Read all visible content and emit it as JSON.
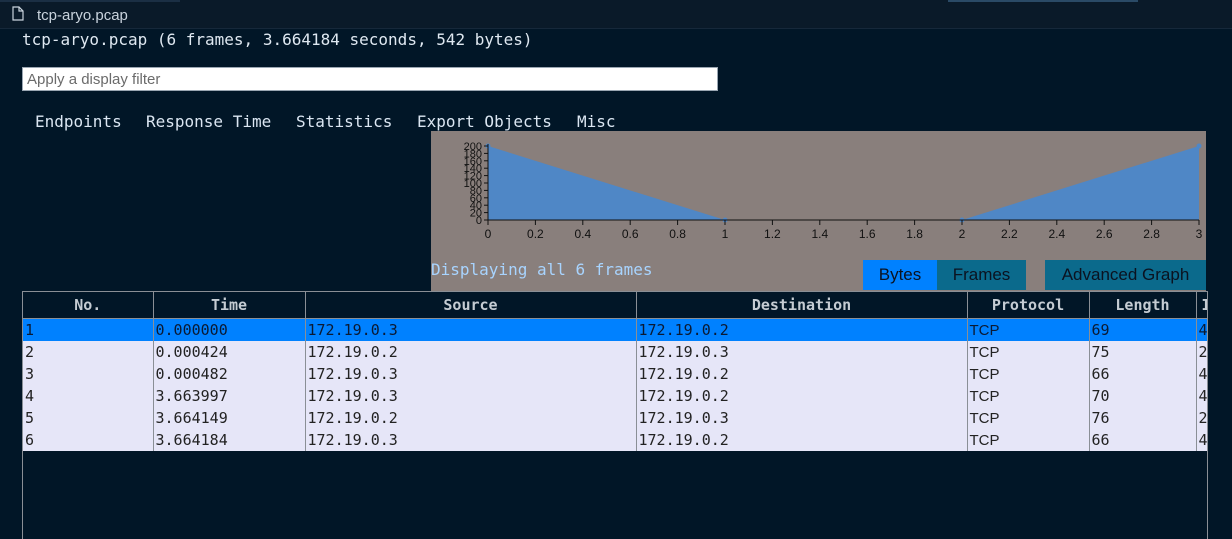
{
  "tab": {
    "title": "tcp-aryo.pcap",
    "icon": "file-icon"
  },
  "summary": "tcp-aryo.pcap (6 frames, 3.664184 seconds, 542 bytes)",
  "filter": {
    "placeholder": "Apply a display filter",
    "value": ""
  },
  "menu": [
    "Endpoints",
    "Response Time",
    "Statistics",
    "Export Objects",
    "Misc"
  ],
  "graph": {
    "x_ticks": [
      "0",
      "0.2",
      "0.4",
      "0.6",
      "0.8",
      "1",
      "1.2",
      "1.4",
      "1.6",
      "1.8",
      "2",
      "2.2",
      "2.4",
      "2.6",
      "2.8",
      "3"
    ],
    "y_ticks": [
      "0",
      "20",
      "40",
      "60",
      "80",
      "100",
      "120",
      "140",
      "160",
      "180",
      "200"
    ],
    "fill_color": "#4f87c6",
    "background": "#897f7c"
  },
  "chart_data": {
    "type": "area",
    "x": [
      0,
      1,
      2,
      3
    ],
    "y": [
      200,
      0,
      0,
      200
    ],
    "xlim": [
      0,
      3
    ],
    "ylim": [
      0,
      200
    ]
  },
  "status": "Displaying all 6 frames",
  "buttons": {
    "bytes": "Bytes",
    "frames": "Frames",
    "advanced": "Advanced Graph"
  },
  "table": {
    "headers": [
      "No.",
      "Time",
      "Source",
      "Destination",
      "Protocol",
      "Length",
      "Info"
    ],
    "rows": [
      [
        "1",
        "0.000000",
        "172.19.0.3",
        "172.19.0.2",
        "TCP",
        "69",
        "4"
      ],
      [
        "2",
        "0.000424",
        "172.19.0.2",
        "172.19.0.3",
        "TCP",
        "75",
        "2"
      ],
      [
        "3",
        "0.000482",
        "172.19.0.3",
        "172.19.0.2",
        "TCP",
        "66",
        "4"
      ],
      [
        "4",
        "3.663997",
        "172.19.0.3",
        "172.19.0.2",
        "TCP",
        "70",
        "4"
      ],
      [
        "5",
        "3.664149",
        "172.19.0.2",
        "172.19.0.3",
        "TCP",
        "76",
        "2"
      ],
      [
        "6",
        "3.664184",
        "172.19.0.3",
        "172.19.0.2",
        "TCP",
        "66",
        "4"
      ]
    ],
    "selected_row": 1
  },
  "colors": {
    "background": "#011627",
    "selected_row": "#0081ff",
    "row": "#e6e6f8",
    "bytes_button": "#0081ff",
    "frames_button": "#0b6a8c",
    "advanced_button": "#0b6a8c"
  }
}
